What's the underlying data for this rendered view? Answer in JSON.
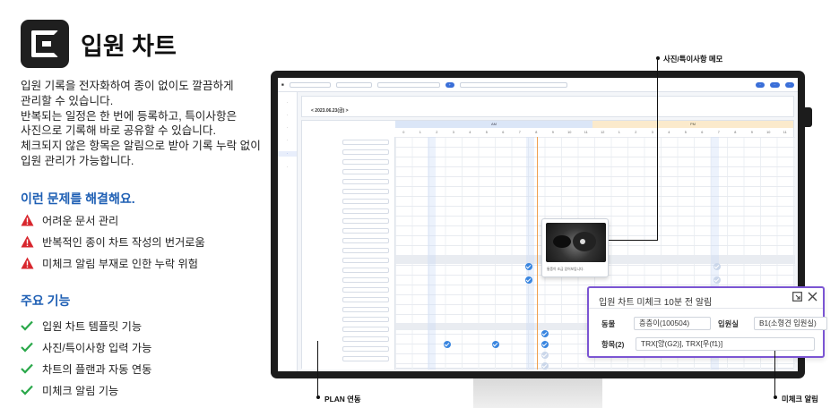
{
  "header": {
    "title": "입원 차트"
  },
  "description": [
    "입원 기록을 전자화하여 종이 없이도 깔끔하게",
    "관리할 수 있습니다.",
    "반복되는 일정은 한 번에 등록하고, 특이사항은",
    "사진으로 기록해 바로 공유할 수 있습니다.",
    "체크되지 않은 항목은 알림으로 받아 기록 누락 없이",
    "입원 관리가 가능합니다."
  ],
  "problems": {
    "title": "이런 문제를 해결해요.",
    "items": [
      "어려운 문서 관리",
      "반복적인 종이 차트 작성의 번거로움",
      "미체크 알림 부재로 인한 누락 위험"
    ]
  },
  "features": {
    "title": "주요 기능",
    "items": [
      "입원 차트 템플릿 기능",
      "사진/특이사항 입력 가능",
      "차트의 플랜과 자동 연동",
      "미체크 알림 기능"
    ]
  },
  "screen": {
    "date": "< 2023.06.23(금) >",
    "am_label": "AM",
    "pm_label": "PM",
    "hours": [
      "0",
      "1",
      "2",
      "3",
      "4",
      "5",
      "6",
      "7",
      "8",
      "9",
      "10",
      "11",
      "12",
      "1",
      "2",
      "3",
      "4",
      "5",
      "6",
      "7",
      "8",
      "9",
      "10",
      "11"
    ],
    "photo_caption": "통증이 조금 있어보입니다."
  },
  "alert": {
    "title": "입원 차트 미체크 10분 전 알림",
    "animal_label": "동물",
    "animal_value": "층층이(100504)",
    "ward_label": "입원실",
    "ward_value": "B1(소형견 입원실)",
    "items_label": "항목(2)",
    "items_value": "TRX[양(G2)], TRX[우(f1)]"
  },
  "callouts": {
    "photo_memo": "사진/특이사항 메모",
    "plan_link": "PLAN 연동",
    "uncheck_alert": "미체크 알림"
  },
  "colors": {
    "accent_blue": "#1e5fb4",
    "alert_border": "#7b55d3",
    "warning_red": "#d8262d",
    "check_green": "#2aa84a"
  }
}
